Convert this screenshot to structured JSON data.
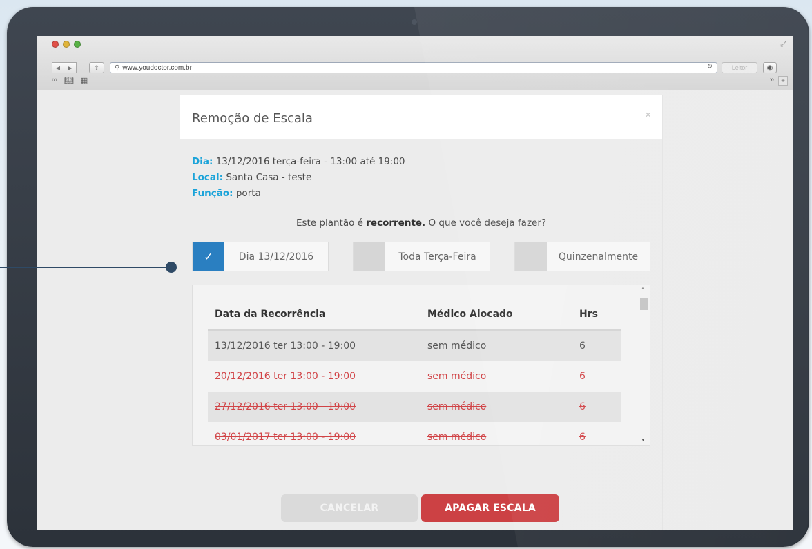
{
  "browser": {
    "url": "www.youdoctor.com.br",
    "reader_label": "Leitor"
  },
  "modal": {
    "title": "Remoção de Escala",
    "info": [
      {
        "key": "Dia:",
        "value": "13/12/2016 terça-feira - 13:00 até 19:00"
      },
      {
        "key": "Local:",
        "value": "Santa Casa - teste"
      },
      {
        "key": "Função:",
        "value": "porta"
      }
    ],
    "question_prefix": "Este plantão é ",
    "question_bold": "recorrente.",
    "question_suffix": " O que você deseja fazer?",
    "options": [
      {
        "label": "Dia 13/12/2016",
        "checked": true
      },
      {
        "label": "Toda Terça-Feira",
        "checked": false
      },
      {
        "label": "Quinzenalmente",
        "checked": false
      }
    ],
    "table": {
      "headers": [
        "Data da Recorrência",
        "Médico Alocado",
        "Hrs"
      ],
      "rows": [
        {
          "date": "13/12/2016 ter 13:00 - 19:00",
          "doctor": "sem médico",
          "hrs": "6",
          "removed": false
        },
        {
          "date": "20/12/2016 ter 13:00 - 19:00",
          "doctor": "sem médico",
          "hrs": "6",
          "removed": true
        },
        {
          "date": "27/12/2016 ter 13:00 - 19:00",
          "doctor": "sem médico",
          "hrs": "6",
          "removed": true
        },
        {
          "date": "03/01/2017 ter 13:00 - 19:00",
          "doctor": "sem médico",
          "hrs": "6",
          "removed": true
        }
      ]
    },
    "cancel_label": "CANCELAR",
    "delete_label": "APAGAR ESCALA"
  },
  "colors": {
    "accent_blue": "#2a7fc1",
    "label_cyan": "#1aa3d9",
    "danger_red": "#cc4144",
    "strike_red": "#d14447"
  }
}
